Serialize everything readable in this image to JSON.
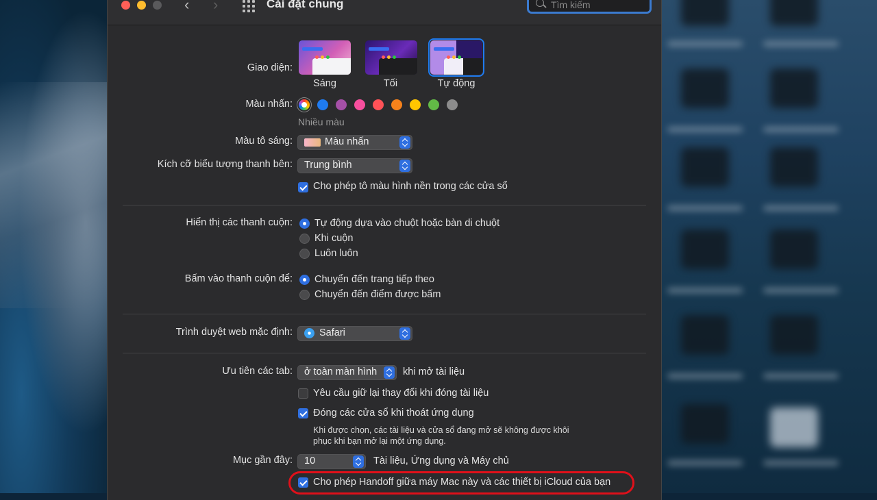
{
  "window": {
    "title": "Cài đặt chung",
    "search_placeholder": "Tìm kiếm"
  },
  "appearance": {
    "label": "Giao diện:",
    "options": [
      "Sáng",
      "Tối",
      "Tự động"
    ],
    "selected": "Tự động"
  },
  "accent": {
    "label": "Màu nhấn:",
    "colors": [
      "multicolor",
      "#1f7bf0",
      "#a550a7",
      "#f74f9e",
      "#ff5257",
      "#f7821b",
      "#ffc600",
      "#62ba46",
      "#8c8c8c"
    ],
    "selected_name": "Nhiều màu"
  },
  "highlight_color": {
    "label": "Màu tô sáng:",
    "value": "Màu nhấn"
  },
  "sidebar_icon_size": {
    "label": "Kích cỡ biểu tượng thanh bên:",
    "value": "Trung bình"
  },
  "wallpaper_tinting": {
    "label": "Cho phép tô màu hình nền trong các cửa sổ",
    "checked": true
  },
  "show_scroll_bars": {
    "label": "Hiển thị các thanh cuộn:",
    "options": [
      "Tự động dựa vào chuột hoặc bàn di chuột",
      "Khi cuộn",
      "Luôn luôn"
    ],
    "selected": 0
  },
  "click_scroll_bar": {
    "label": "Bấm vào thanh cuộn để:",
    "options": [
      "Chuyển đến trang tiếp theo",
      "Chuyển đến điểm được bấm"
    ],
    "selected": 0
  },
  "default_browser": {
    "label": "Trình duyệt web mặc định:",
    "value": "Safari"
  },
  "prefer_tabs": {
    "label": "Ưu tiên các tab:",
    "value": "ở toàn màn hình",
    "suffix": "khi mở tài liệu"
  },
  "ask_keep_changes": {
    "label": "Yêu cầu giữ lại thay đổi khi đóng tài liệu",
    "checked": false
  },
  "close_windows": {
    "label": "Đóng các cửa sổ khi thoát ứng dụng",
    "checked": true,
    "description_line1": "Khi được chọn, các tài liệu và cửa sổ đang mở sẽ không được khôi",
    "description_line2": "phục khi bạn mở lại một ứng dụng."
  },
  "recent_items": {
    "label": "Mục gần đây:",
    "value": "10",
    "suffix": "Tài liệu, Ứng dụng và Máy chủ"
  },
  "handoff": {
    "label": "Cho phép Handoff giữa máy Mac này và các thiết bị iCloud của bạn",
    "checked": true
  },
  "colors": {
    "window_bg": "#2b2b2d",
    "accent_blue": "#2f6fe0",
    "annotation_red": "#e0101a"
  }
}
